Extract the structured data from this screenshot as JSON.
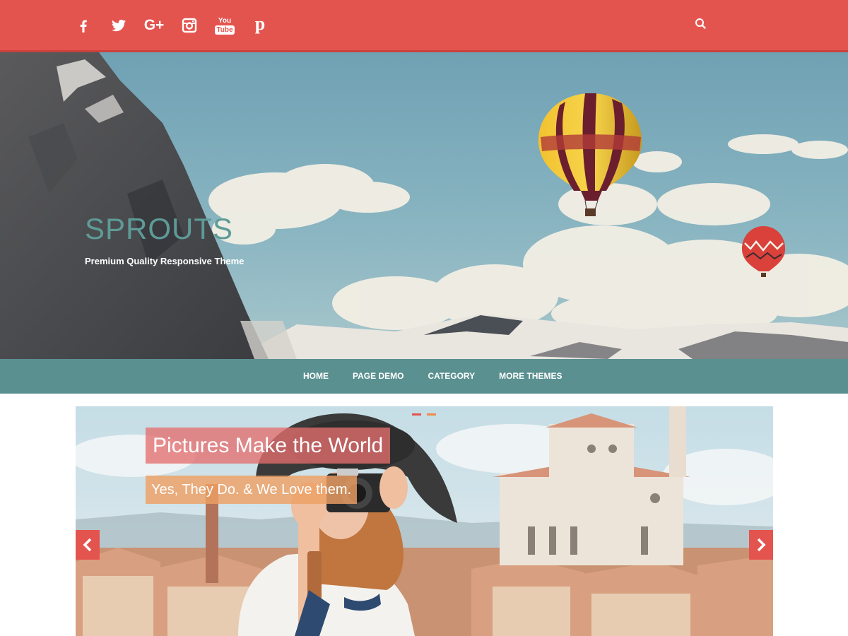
{
  "social": {
    "items": [
      {
        "name": "facebook-icon"
      },
      {
        "name": "twitter-icon"
      },
      {
        "name": "google-plus-icon",
        "glyph": "G+"
      },
      {
        "name": "instagram-icon"
      },
      {
        "name": "youtube-icon",
        "glyph_top": "You",
        "glyph_bottom": "Tube"
      },
      {
        "name": "pinterest-icon",
        "glyph": "p"
      }
    ]
  },
  "header": {
    "site_title": "SPROUTS",
    "site_description": "Premium Quality Responsive Theme"
  },
  "nav": {
    "items": [
      "HOME",
      "PAGE DEMO",
      "CATEGORY",
      "MORE THEMES"
    ]
  },
  "slider": {
    "caption_title": "Pictures Make the World",
    "caption_subtitle": "Yes, They Do. & We Love them."
  },
  "colors": {
    "topbar": "#e4544f",
    "nav": "#5a9090",
    "site_title": "#5e9b97",
    "dot_active": "#e4544f",
    "dot_inactive": "#ee8a4a"
  }
}
